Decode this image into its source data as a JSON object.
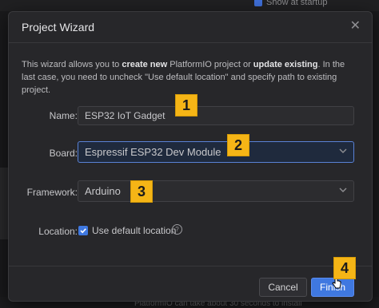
{
  "background": {
    "startup_label": "Show at startup",
    "footer_text": "PlatformIO can take about 30 seconds to install"
  },
  "dialog": {
    "title": "Project Wizard",
    "intro": {
      "part1": "This wizard allows you to ",
      "bold1": "create new",
      "part2": " PlatformIO project or ",
      "bold2": "update existing",
      "part3": ". In the last case, you need to uncheck \"Use default location\" and specify path to existing project."
    },
    "name": {
      "label": "Name:",
      "value": "ESP32 IoT Gadget"
    },
    "board": {
      "label": "Board:",
      "value": "Espressif ESP32 Dev Module"
    },
    "framework": {
      "label": "Framework:",
      "value": "Arduino"
    },
    "location": {
      "label": "Location:",
      "checkbox_label": "Use default location",
      "checked": true
    },
    "buttons": {
      "cancel": "Cancel",
      "finish": "Finish"
    }
  },
  "badges": [
    "1",
    "2",
    "3",
    "4"
  ],
  "colors": {
    "accent": "#3f78e0",
    "badge": "#f5b516",
    "dialog_bg": "#27272a"
  }
}
